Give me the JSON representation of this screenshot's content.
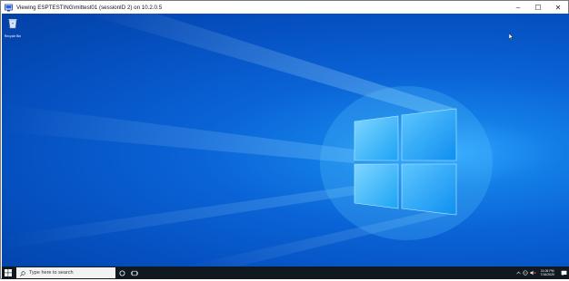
{
  "window": {
    "title": "Viewing ESPTESTING\\mittest01 (sessionID 2) on 10.2.0.5",
    "controls": {
      "minimize": "–",
      "maximize": "☐",
      "close": "✕"
    }
  },
  "desktop": {
    "recycle_bin_label": "Recycle Bin"
  },
  "taskbar": {
    "search_placeholder": "Type here to search",
    "clock_time": "11:06 PM",
    "clock_date": "7/16/2020",
    "colors": {
      "taskbar": "#101820",
      "search": "#f2f2f2"
    }
  },
  "colors": {
    "desktop_accent": "#137ee6",
    "logo_glow": "#6fd0ff"
  }
}
